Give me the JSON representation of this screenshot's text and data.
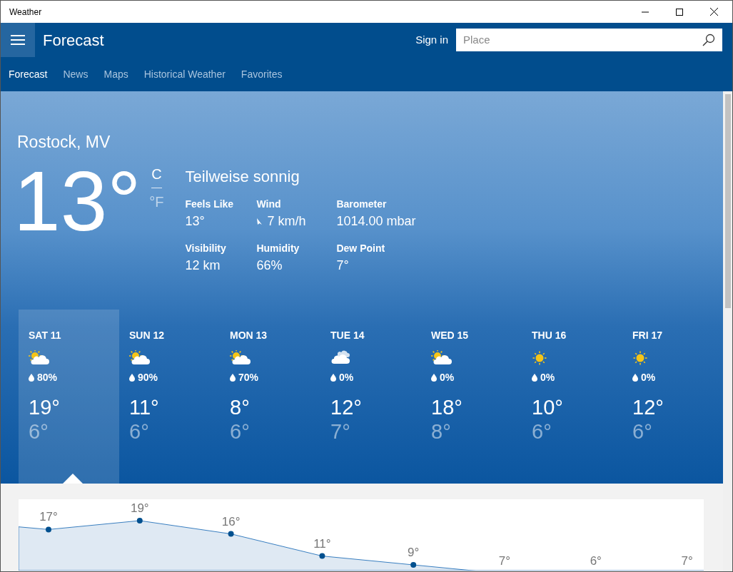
{
  "window": {
    "title": "Weather"
  },
  "header": {
    "title": "Forecast",
    "sign_in": "Sign in",
    "search": {
      "placeholder": "Place"
    }
  },
  "tabs": [
    {
      "label": "Forecast",
      "selected": true
    },
    {
      "label": "News",
      "selected": false
    },
    {
      "label": "Maps",
      "selected": false
    },
    {
      "label": "Historical Weather",
      "selected": false
    },
    {
      "label": "Favorites",
      "selected": false
    }
  ],
  "current": {
    "location": "Rostock, MV",
    "temperature": "13°",
    "units": [
      {
        "label": "C",
        "selected": true
      },
      {
        "label": "°F",
        "selected": false
      }
    ],
    "condition": "Teilweise sonnig",
    "details": [
      {
        "label": "Feels Like",
        "value": "13°"
      },
      {
        "label": "Wind",
        "value": "7 km/h",
        "kind": "wind"
      },
      {
        "label": "Barometer",
        "value": "1014.00 mbar"
      },
      {
        "label": "Visibility",
        "value": "12 km"
      },
      {
        "label": "Humidity",
        "value": "66%"
      },
      {
        "label": "Dew Point",
        "value": "7°"
      }
    ]
  },
  "days": [
    {
      "day": "SAT 11",
      "kind": "partly-sunny",
      "precip": "80%",
      "high": "19°",
      "low": "6°",
      "selected": true
    },
    {
      "day": "SUN 12",
      "kind": "partly-sunny",
      "precip": "90%",
      "high": "11°",
      "low": "6°",
      "selected": false
    },
    {
      "day": "MON 13",
      "kind": "partly-sunny",
      "precip": "70%",
      "high": "8°",
      "low": "6°",
      "selected": false
    },
    {
      "day": "TUE 14",
      "kind": "cloudy",
      "precip": "0%",
      "high": "12°",
      "low": "7°",
      "selected": false
    },
    {
      "day": "WED 15",
      "kind": "partly-sunny",
      "precip": "0%",
      "high": "18°",
      "low": "8°",
      "selected": false
    },
    {
      "day": "THU 16",
      "kind": "sunny",
      "precip": "0%",
      "high": "10°",
      "low": "6°",
      "selected": false
    },
    {
      "day": "FRI 17",
      "kind": "sunny",
      "precip": "0%",
      "high": "12°",
      "low": "6°",
      "selected": false
    }
  ],
  "hourly": {
    "labels": [
      "17°",
      "19°",
      "16°",
      "11°",
      "9°",
      "7°",
      "6°",
      "7°"
    ]
  }
}
